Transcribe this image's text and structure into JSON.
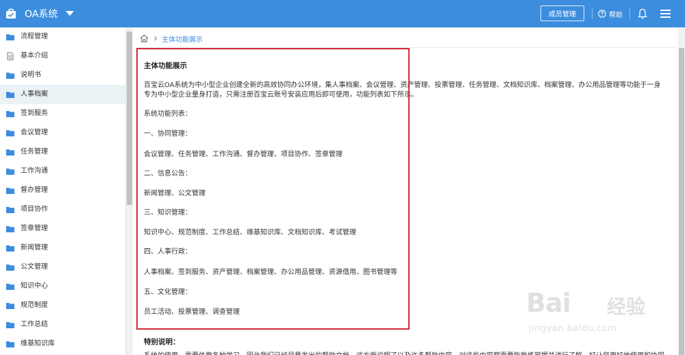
{
  "app": {
    "title": "OA系统",
    "member_button": "成员管理",
    "help_label": "帮助",
    "accent_color": "#3c8dde",
    "highlight_color": "#d0293a"
  },
  "sidebar": {
    "items": [
      {
        "label": "流程管理",
        "icon": "folder-icon"
      },
      {
        "label": "基本介绍",
        "icon": "document-icon"
      },
      {
        "label": "说明书",
        "icon": "folder-icon"
      },
      {
        "label": "人事档案",
        "icon": "folder-icon",
        "active": true
      },
      {
        "label": "签到服务",
        "icon": "folder-icon"
      },
      {
        "label": "会议管理",
        "icon": "folder-icon"
      },
      {
        "label": "任务管理",
        "icon": "folder-icon"
      },
      {
        "label": "工作沟通",
        "icon": "folder-icon"
      },
      {
        "label": "督办管理",
        "icon": "folder-icon"
      },
      {
        "label": "项目协作",
        "icon": "folder-icon"
      },
      {
        "label": "签章管理",
        "icon": "folder-icon"
      },
      {
        "label": "新闻管理",
        "icon": "folder-icon"
      },
      {
        "label": "公文管理",
        "icon": "folder-icon"
      },
      {
        "label": "知识中心",
        "icon": "folder-icon"
      },
      {
        "label": "规范制度",
        "icon": "folder-icon"
      },
      {
        "label": "工作总结",
        "icon": "folder-icon"
      },
      {
        "label": "维基知识库",
        "icon": "folder-icon"
      }
    ]
  },
  "breadcrumb": {
    "current": "主体功能展示"
  },
  "article": {
    "heading": "主体功能展示",
    "intro_line1": "百宝云OA系统为中小型企业创建全新的高效协同办公环境，集人事档案、会议管理、资产管理、投票管理、任务管理、文档知识库、档案管理、办公用品管理等功能于一身",
    "intro_line2": "专为中小型企业量身打造，只需注册百宝云账号安装应用后即可使用，功能列表如下所示。",
    "list_title": "系统功能列表：",
    "sections": [
      {
        "title": "一、协同管理：",
        "items": "会议管理、任务管理、工作沟通、督办管理、项目协作、签章管理"
      },
      {
        "title": "二、信息公告：",
        "items": "新闻管理、公文管理"
      },
      {
        "title": "三、知识管理：",
        "items": "知识中心、规范制度、工作总结、维基知识库、文档知识库、考试管理"
      },
      {
        "title": "四、人事行政：",
        "items": "人事档案、签到服务、资产管理、档案管理、办公用品管理、资源借用、图书管理等"
      },
      {
        "title": "五、文化管理：",
        "items": "员工活动、投票管理、调查管理"
      }
    ]
  },
  "note": {
    "title": "特别说明：",
    "text": "系统的使用，需要依靠各种学习，因此我们已经尽量发出的帮助文档，这方面说明了以及许多帮助内容，对这些内容都需要能熟练掌握并进行了解，好让您更好地使用和协同"
  },
  "watermark": {
    "brand": "Bai",
    "brand_suffix": "经验",
    "url": "jingyan.baidu.com"
  }
}
